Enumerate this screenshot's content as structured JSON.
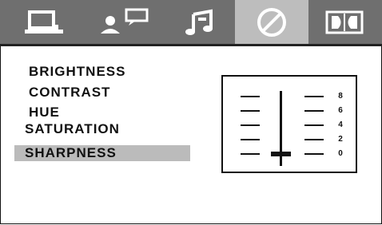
{
  "tabs": [
    {
      "icon": "monitor-icon"
    },
    {
      "icon": "user-message-icon"
    },
    {
      "icon": "music-note-icon"
    },
    {
      "icon": "forbidden-circle-icon",
      "active": true
    },
    {
      "icon": "dolby-icon"
    }
  ],
  "menu": {
    "items": [
      "BRIGHTNESS",
      "CONTRAST",
      "HUE",
      "SATURATION",
      "SHARPNESS"
    ],
    "selected": "SHARPNESS"
  },
  "slider": {
    "scale": [
      "8",
      "6",
      "4",
      "2",
      "0"
    ],
    "value": 0,
    "min": 0,
    "max": 8
  },
  "colors": {
    "tabbar": "#6f6f6f",
    "active_tab": "#bdbdbd",
    "selected_row": "#bbbbbb"
  }
}
